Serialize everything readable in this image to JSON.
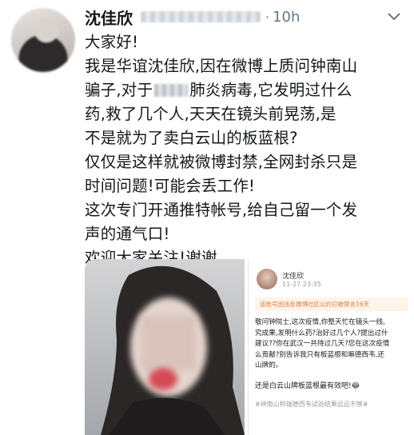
{
  "tweet": {
    "author_name": "沈佳欣",
    "dot": "·",
    "time": "10h",
    "lines": [
      "大家好!",
      "我是华谊沈佳欣,因在微博上质问钟南山",
      "骗子,对于",
      "肺炎病毒,它发明过什么",
      "药,救了几个人,天天在镜头前晃荡,是",
      "不是就为了卖白云山的板蓝根?",
      "仅仅是这样就被微博封禁,全网封杀只是",
      "时间问题!可能会丢工作!",
      "这次专门开通推特帐号,给自己留一个发",
      "声的通气口!",
      "欢迎大家关注!谢谢"
    ]
  },
  "embedded_post": {
    "author": "沈佳欣",
    "time": "11-27 23:35",
    "notice": "该账号因违反微博社区公约已被禁言16天",
    "paragraph_lines": [
      "敬问钟院士,这次疫情,你整天忙在镜头一线,",
      "究成果,发明什么药?治好过几个人?提出过什",
      "建议??你在武汉一共待过几天?您在这次疫情",
      "么贡献?别告诉我只有板蓝根和嘛德西韦,还",
      "山牌的。"
    ],
    "punchline": "还是白云山牌板蓝根最有效吧!😂",
    "hashtag": "#钟南山称瑞德西韦试验结果远远不够#"
  },
  "icons": {
    "menu": "chevron-down-icon"
  },
  "colors": {
    "text": "#14171a",
    "muted": "#657786",
    "notice": "#e07a38"
  }
}
